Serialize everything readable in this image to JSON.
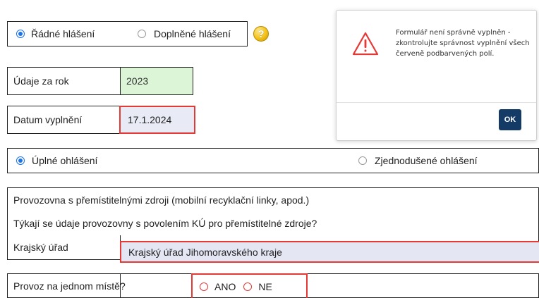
{
  "report_type": {
    "option1": "Řádné hlášení",
    "option2": "Doplněné hlášení",
    "selected": "Řádné hlášení",
    "help_icon": "?"
  },
  "year": {
    "label": "Údaje za rok",
    "value": "2023"
  },
  "date": {
    "label": "Datum vyplnění",
    "value": "17.1.2024"
  },
  "report_scope": {
    "option1": "Úplné ohlášení",
    "option2": "Zjednodušené ohlášení",
    "selected": "Úplné ohlášení"
  },
  "mobile": {
    "header": "Provozovna s přemístitelnými zdroji (mobilní recyklační linky, apod.)",
    "question": "Týkají se údaje provozovny s povolením KÚ pro přemístitelné zdroje?",
    "region_label": "Krajský úřad",
    "region_value": "Krajský úřad Jihomoravského kraje",
    "place_label": "Provoz na jednom místě?",
    "yes": "ANO",
    "no": "NE"
  },
  "dialog": {
    "message": "Formulář není správně vyplněn - zkontrolujte správnost vyplnění všech červeně podbarvených polí.",
    "ok_label": "OK",
    "icon": "warning-icon"
  },
  "colors": {
    "year_field_bg": "#dcf5d6",
    "date_field_bg": "#e8eaf6",
    "region_field_bg": "#e4e6f4",
    "error_border": "#e53935",
    "radio_selected": "#1a73e8",
    "ok_button": "#143a66"
  }
}
